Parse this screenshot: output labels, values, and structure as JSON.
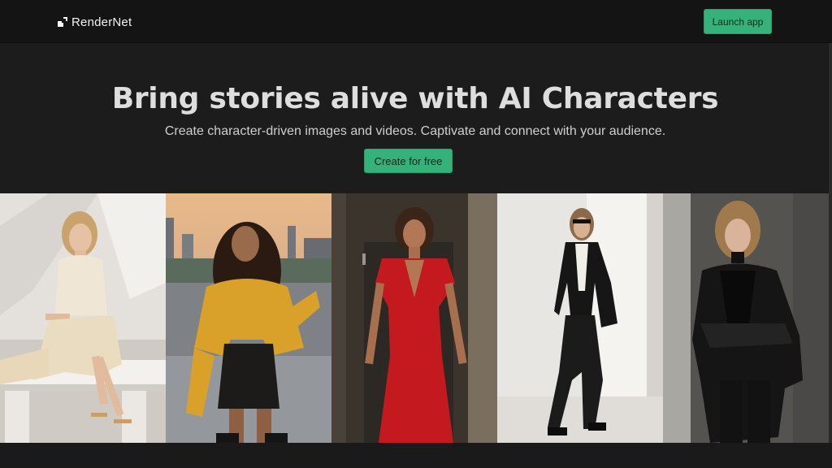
{
  "nav": {
    "brand_name": "RenderNet",
    "launch_label": "Launch app"
  },
  "hero": {
    "title": "Bring stories alive with AI Characters",
    "subtitle": "Create character-driven images and videos. Captivate and connect with your audience.",
    "cta_label": "Create for free"
  },
  "gallery": {
    "items": [
      {
        "name": "woman-cream-outfit-photo"
      },
      {
        "name": "woman-yellow-sweater-photo"
      },
      {
        "name": "woman-red-dress-photo"
      },
      {
        "name": "woman-black-suit-photo"
      },
      {
        "name": "woman-leather-jacket-photo"
      }
    ]
  },
  "colors": {
    "accent": "#35b27a",
    "background": "#1c1c1c",
    "navbar": "#141414"
  }
}
